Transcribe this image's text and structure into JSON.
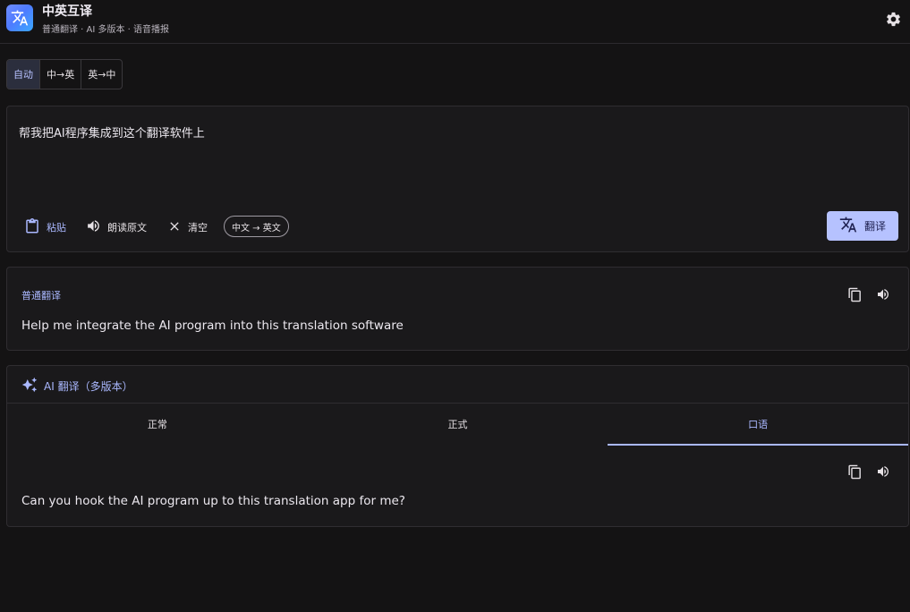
{
  "header": {
    "title": "中英互译",
    "subtitle": "普通翻译 · AI 多版本 · 语音播报",
    "logo_icon": "translate-icon",
    "settings_icon": "gear-icon"
  },
  "modes": [
    "自动",
    "中→英",
    "英→中"
  ],
  "active_mode": "自动",
  "input": {
    "text": "帮我把AI程序集成到这个翻译软件上",
    "paste_label": "粘贴",
    "read_label": "朗读原文",
    "clear_label": "清空",
    "lang_chip": "中文 → 英文",
    "translate_label": "翻译"
  },
  "normal": {
    "label": "普通翻译",
    "text": "Help me integrate the AI program into this translation software"
  },
  "ai": {
    "title": "AI 翻译（多版本）",
    "tabs": [
      "正常",
      "正式",
      "口语"
    ],
    "active_tab": "口语",
    "text": "Can you hook the AI program up to this translation app for me?"
  },
  "colors": {
    "accent": "#aab8ff",
    "primary_button": "#b6c2ff",
    "background": "#141314",
    "card": "#1a191b"
  }
}
